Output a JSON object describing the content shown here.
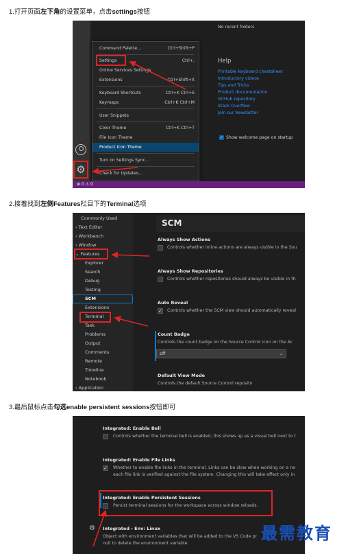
{
  "steps": {
    "step1": {
      "prefix": "1.打开页面",
      "bold1": "左下角",
      "middle": "的设置菜单，点击",
      "bold2": "settings",
      "suffix": "按钮"
    },
    "step2": {
      "prefix": "2.接着找到",
      "bold1": "左侧Features",
      "middle": "栏目下的",
      "bold2": "Terminal",
      "suffix": "选项"
    },
    "step3": {
      "prefix": "3.最后鼠标点击",
      "bold1": "勾选enable persistent sessions",
      "suffix": "按钮即可"
    }
  },
  "shot1": {
    "no_recent": "No recent folders",
    "help_title": "Help",
    "help_links": [
      "Printable keyboard cheatsheet",
      "Introductory videos",
      "Tips and Tricks",
      "Product documentation",
      "GitHub repository",
      "Stack Overflow",
      "Join our Newsletter"
    ],
    "show_welcome": "Show welcome page on startup",
    "status_bar": "⊗ 0 ⚠ 0",
    "menu": [
      {
        "label": "Command Palette...",
        "shortcut": "Ctrl+Shift+P"
      },
      {
        "label": "Settings",
        "shortcut": "Ctrl+,"
      },
      {
        "label": "Online Services Settings",
        "shortcut": ""
      },
      {
        "label": "Extensions",
        "shortcut": "Ctrl+Shift+X"
      },
      {
        "label": "Keyboard Shortcuts",
        "shortcut": "Ctrl+K Ctrl+S"
      },
      {
        "label": "Keymaps",
        "shortcut": "Ctrl+K Ctrl+M"
      },
      {
        "label": "User Snippets",
        "shortcut": ""
      },
      {
        "label": "Color Theme",
        "shortcut": "Ctrl+K Ctrl+T"
      },
      {
        "label": "File Icon Theme",
        "shortcut": ""
      },
      {
        "label": "Product Icon Theme",
        "shortcut": ""
      },
      {
        "label": "Turn on Settings Sync...",
        "shortcut": ""
      },
      {
        "label": "Check for Updates...",
        "shortcut": ""
      }
    ]
  },
  "shot2": {
    "tree": [
      "Commonly Used",
      "Text Editor",
      "Workbench",
      "Window",
      "Features",
      "Explorer",
      "Search",
      "Debug",
      "Testing",
      "SCM",
      "Extensions",
      "Terminal",
      "Task",
      "Problems",
      "Output",
      "Comments",
      "Remote",
      "Timeline",
      "Notebook",
      "Application"
    ],
    "section_title": "SCM",
    "settings": [
      {
        "title": "Always Show Actions",
        "desc": "Controls whether inline actions are always visible in the Sou"
      },
      {
        "title": "Always Show Repositories",
        "desc": "Controls whether repositories should always be visible in th"
      },
      {
        "title": "Auto Reveal",
        "desc": "Controls whether the SCM view should automatically reveal"
      },
      {
        "title": "Count Badge",
        "desc": "Controls the count badge on the Source Control icon on the Ac"
      },
      {
        "title": "Default View Mode",
        "desc": "Controls the default Source Control reposito"
      }
    ],
    "count_badge_value": "off"
  },
  "shot3": {
    "settings": [
      {
        "title_prefix": "Integrated: ",
        "title": "Enable Bell",
        "desc": "Controls whether the terminal bell is enabled, this shows up as a visual bell next to t",
        "desc2": ""
      },
      {
        "title_prefix": "Integrated: ",
        "title": "Enable File Links",
        "desc": "Whether to enable file links in the terminal. Links can be slow when working on a ne",
        "desc2": "each file link is verified against the file system. Changing this will take effect only in"
      },
      {
        "title_prefix": "Integrated: ",
        "title": "Enable Persistent Sessions",
        "desc": "Persist terminal sessions for the workspace across window reloads.",
        "desc2": ""
      },
      {
        "title_prefix": "Integrated › Env: ",
        "title": "Linux",
        "desc": "Object with environment variables that will be added to the VS Code pr",
        "desc2": "null to delete the environment variable."
      }
    ]
  },
  "watermark": "最需教育"
}
